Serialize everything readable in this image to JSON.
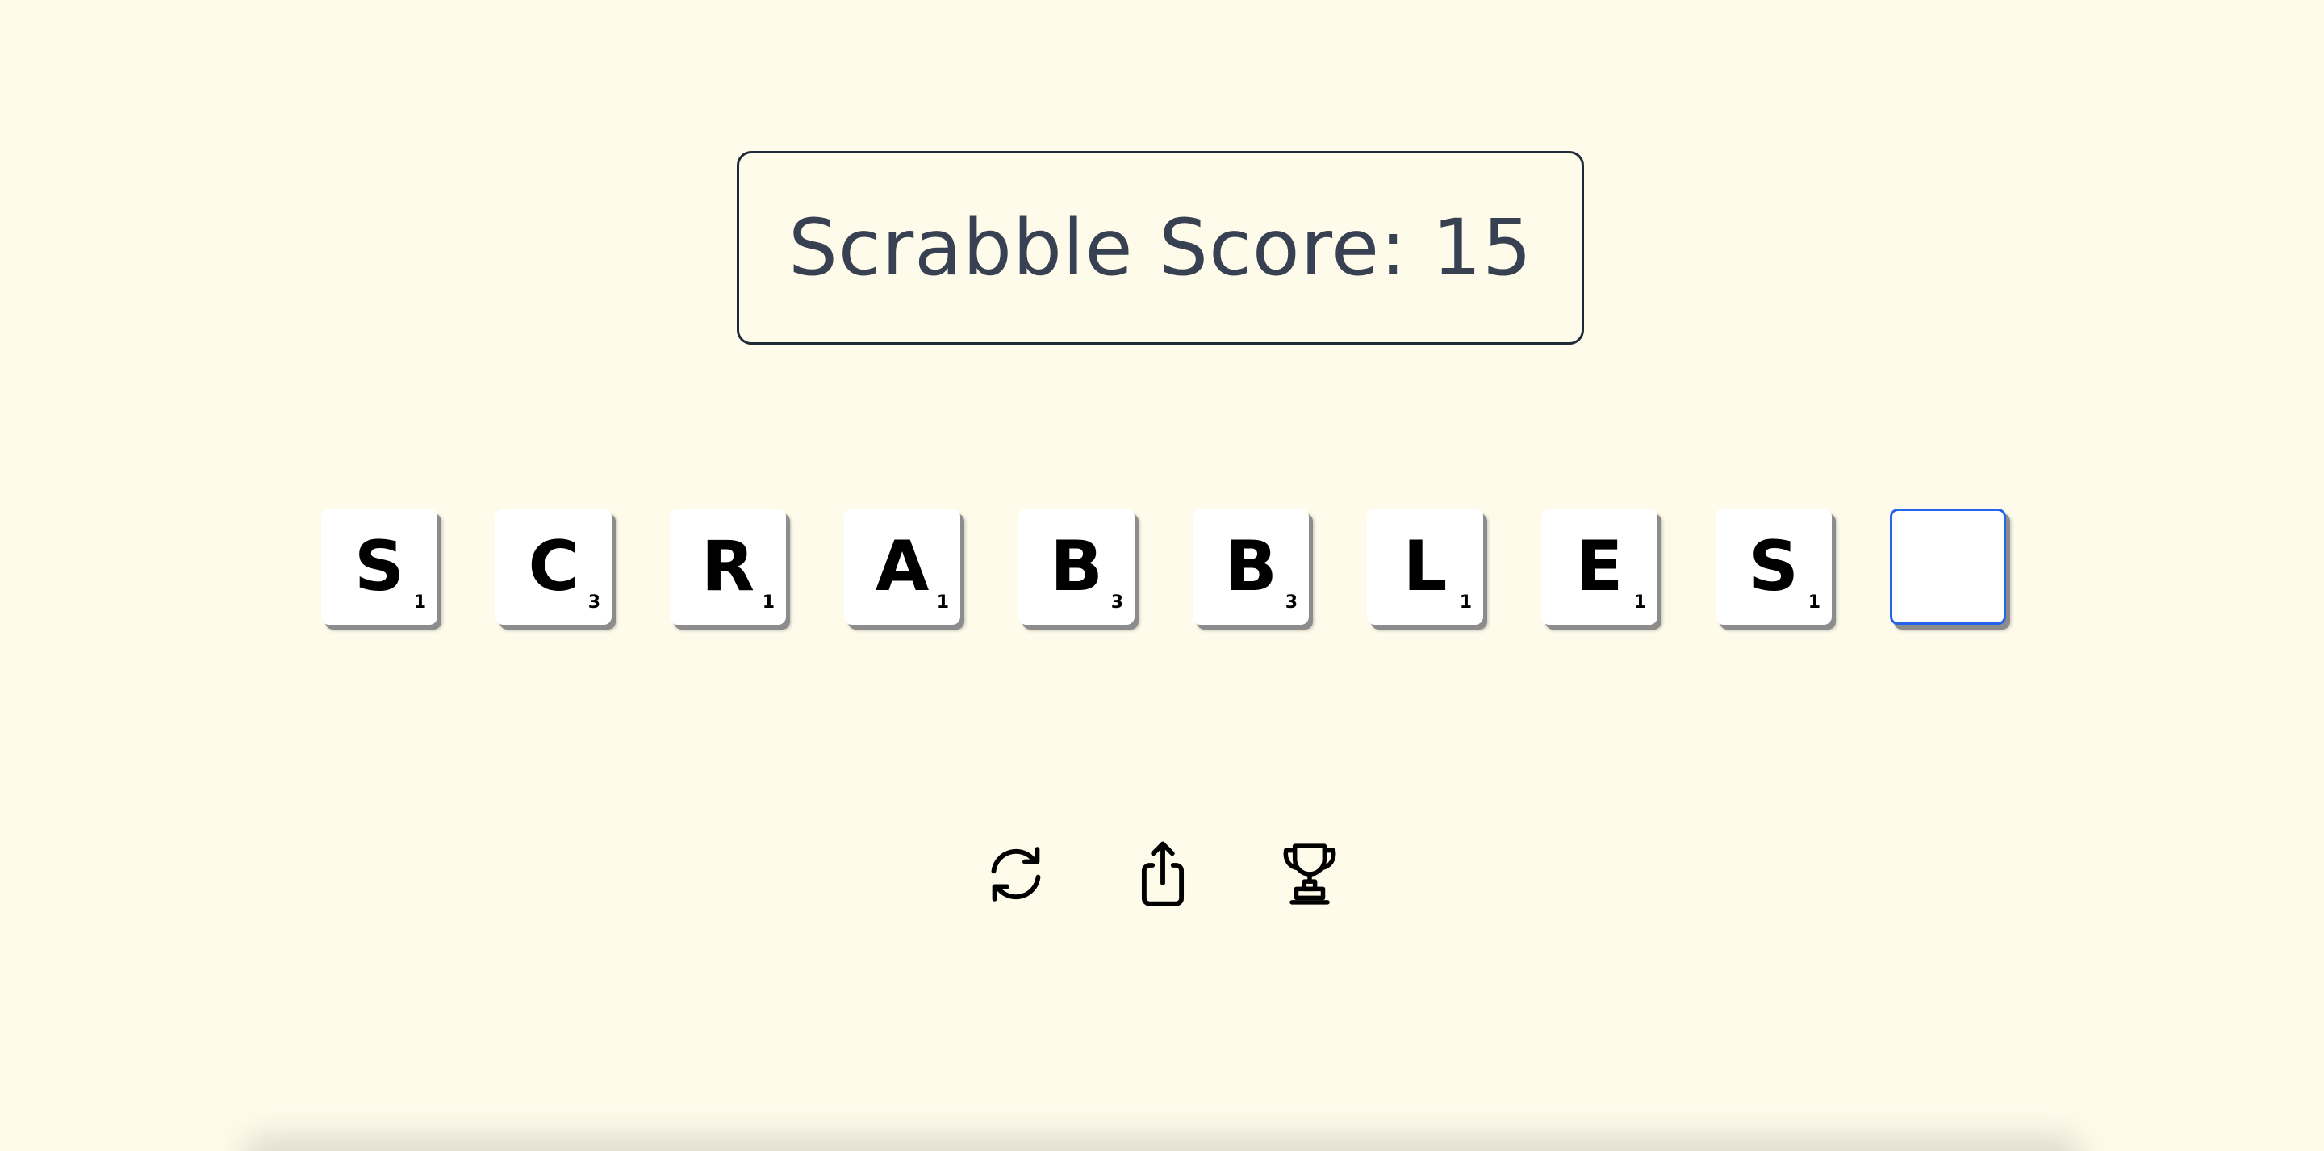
{
  "score": {
    "text": "Scrabble Score: 15"
  },
  "tiles": [
    {
      "letter": "S",
      "points": "1"
    },
    {
      "letter": "C",
      "points": "3"
    },
    {
      "letter": "R",
      "points": "1"
    },
    {
      "letter": "A",
      "points": "1"
    },
    {
      "letter": "B",
      "points": "3"
    },
    {
      "letter": "B",
      "points": "3"
    },
    {
      "letter": "L",
      "points": "1"
    },
    {
      "letter": "E",
      "points": "1"
    },
    {
      "letter": "S",
      "points": "1"
    }
  ],
  "empty_tile": {
    "letter": "",
    "state": "focused"
  },
  "actions": [
    {
      "icon": "refresh-icon"
    },
    {
      "icon": "share-icon"
    },
    {
      "icon": "trophy-icon"
    }
  ],
  "colors": {
    "background": "#fefbeb",
    "score_text": "#374151",
    "focus_border": "#2563eb",
    "tile_bg": "#ffffff"
  }
}
